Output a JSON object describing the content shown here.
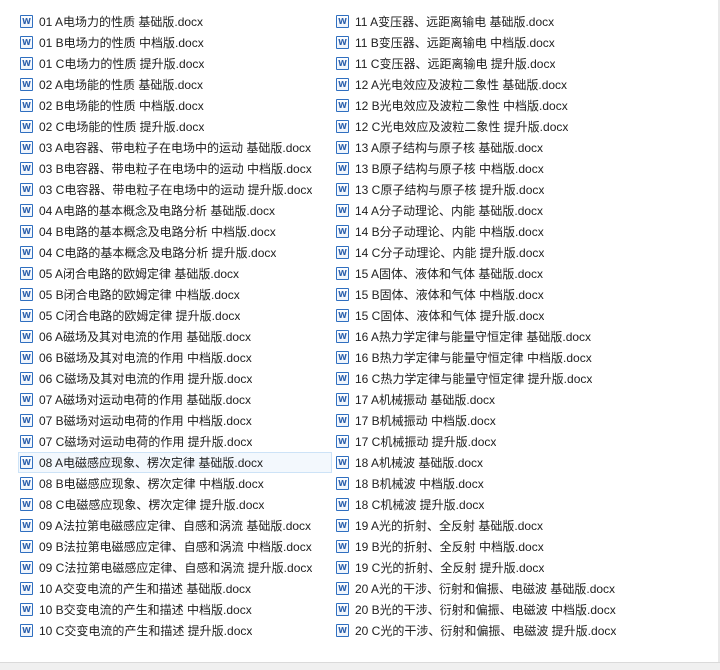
{
  "icon": {
    "name": "word-document-icon",
    "glyph": "W",
    "color": "#2b5fab"
  },
  "selection": {
    "color": "#cde3f7"
  },
  "files_left": [
    "01 A电场力的性质 基础版.docx",
    "01 B电场力的性质 中档版.docx",
    "01 C电场力的性质 提升版.docx",
    "02 A电场能的性质 基础版.docx",
    "02 B电场能的性质 中档版.docx",
    "02 C电场能的性质 提升版.docx",
    "03 A电容器、带电粒子在电场中的运动 基础版.docx",
    "03 B电容器、带电粒子在电场中的运动 中档版.docx",
    "03 C电容器、带电粒子在电场中的运动 提升版.docx",
    "04 A电路的基本概念及电路分析 基础版.docx",
    "04 B电路的基本概念及电路分析 中档版.docx",
    "04 C电路的基本概念及电路分析 提升版.docx",
    "05 A闭合电路的欧姆定律 基础版.docx",
    "05 B闭合电路的欧姆定律 中档版.docx",
    "05 C闭合电路的欧姆定律 提升版.docx",
    "06 A磁场及其对电流的作用 基础版.docx",
    "06 B磁场及其对电流的作用 中档版.docx",
    "06 C磁场及其对电流的作用 提升版.docx",
    "07 A磁场对运动电荷的作用 基础版.docx",
    "07 B磁场对运动电荷的作用 中档版.docx",
    "07 C磁场对运动电荷的作用 提升版.docx",
    "08 A电磁感应现象、楞次定律 基础版.docx",
    "08 B电磁感应现象、楞次定律 中档版.docx",
    "08 C电磁感应现象、楞次定律 提升版.docx",
    "09 A法拉第电磁感应定律、自感和涡流 基础版.docx",
    "09 B法拉第电磁感应定律、自感和涡流 中档版.docx",
    "09 C法拉第电磁感应定律、自感和涡流 提升版.docx",
    "10 A交变电流的产生和描述 基础版.docx",
    "10 B交变电流的产生和描述 中档版.docx",
    "10 C交变电流的产生和描述 提升版.docx"
  ],
  "files_right": [
    "11 A变压器、远距离输电 基础版.docx",
    "11 B变压器、远距离输电 中档版.docx",
    "11 C变压器、远距离输电 提升版.docx",
    "12 A光电效应及波粒二象性 基础版.docx",
    "12 B光电效应及波粒二象性 中档版.docx",
    "12 C光电效应及波粒二象性 提升版.docx",
    "13 A原子结构与原子核 基础版.docx",
    "13 B原子结构与原子核 中档版.docx",
    "13 C原子结构与原子核 提升版.docx",
    "14 A分子动理论、内能 基础版.docx",
    "14 B分子动理论、内能 中档版.docx",
    "14 C分子动理论、内能 提升版.docx",
    "15 A固体、液体和气体 基础版.docx",
    "15 B固体、液体和气体 中档版.docx",
    "15 C固体、液体和气体 提升版.docx",
    "16 A热力学定律与能量守恒定律 基础版.docx",
    "16 B热力学定律与能量守恒定律 中档版.docx",
    "16 C热力学定律与能量守恒定律 提升版.docx",
    "17 A机械振动 基础版.docx",
    "17 B机械振动 中档版.docx",
    "17 C机械振动 提升版.docx",
    "18 A机械波 基础版.docx",
    "18 B机械波 中档版.docx",
    "18 C机械波 提升版.docx",
    "19 A光的折射、全反射 基础版.docx",
    "19 B光的折射、全反射 中档版.docx",
    "19 C光的折射、全反射 提升版.docx",
    "20 A光的干涉、衍射和偏振、电磁波 基础版.docx",
    "20 B光的干涉、衍射和偏振、电磁波 中档版.docx",
    "20 C光的干涉、衍射和偏振、电磁波 提升版.docx"
  ]
}
